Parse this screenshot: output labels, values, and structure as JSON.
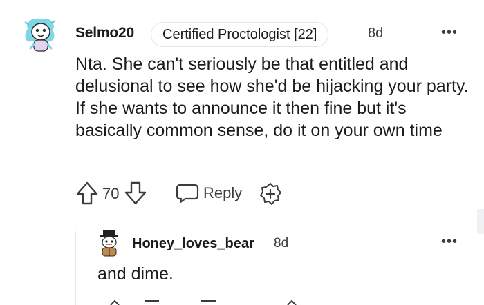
{
  "comment": {
    "username": "Selmo20",
    "flair": "Certified Proctologist [22]",
    "age": "8d",
    "more_label": "•••",
    "body": "Nta. She can't seriously be that entitled and delusional to see how she'd be hijacking your party. If she wants to announce it then fine but it's basically common sense, do it on your own time",
    "votes": "70",
    "reply_label": "Reply",
    "icons": {
      "avatar": "snoo-avatar",
      "upvote": "upvote-arrow-icon",
      "downvote": "downvote-arrow-icon",
      "reply": "speech-bubble-icon",
      "award": "award-plus-icon"
    },
    "avatar_colors": {
      "hair": "#7fd6e6",
      "face": "#ffffff",
      "body": "#e4d4f0"
    }
  },
  "reply": {
    "username": "Honey_loves_bear",
    "age": "8d",
    "more_label": "•••",
    "body": "and dime.",
    "avatar_colors": {
      "hat": "#222222",
      "face": "#ffffff",
      "body": "#c08a4a"
    }
  },
  "colors": {
    "text": "#1c1c1c",
    "meta": "#3c3c3c",
    "border": "#e3e5e8",
    "thread_line": "#e8eaec"
  }
}
